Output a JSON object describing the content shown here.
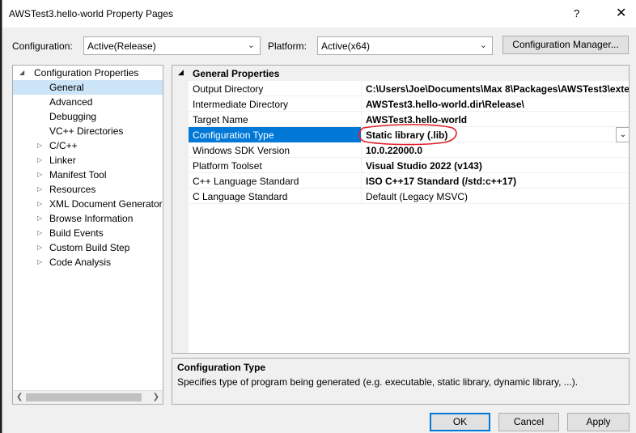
{
  "window": {
    "title": "AWSTest3.hello-world Property Pages",
    "help_glyph": "?",
    "close_glyph": "✕"
  },
  "toolbar": {
    "configuration_label": "Configuration:",
    "configuration_value": "Active(Release)",
    "platform_label": "Platform:",
    "platform_value": "Active(x64)",
    "configuration_manager_label": "Configuration Manager..."
  },
  "tree": {
    "root": "Configuration Properties",
    "items": [
      "General",
      "Advanced",
      "Debugging",
      "VC++ Directories",
      "C/C++",
      "Linker",
      "Manifest Tool",
      "Resources",
      "XML Document Generator",
      "Browse Information",
      "Build Events",
      "Custom Build Step",
      "Code Analysis"
    ],
    "selected": "General"
  },
  "grid": {
    "category": "General Properties",
    "rows": [
      {
        "name": "Output Directory",
        "value": "C:\\Users\\Joe\\Documents\\Max 8\\Packages\\AWSTest3\\exte"
      },
      {
        "name": "Intermediate Directory",
        "value": "AWSTest3.hello-world.dir\\Release\\"
      },
      {
        "name": "Target Name",
        "value": "AWSTest3.hello-world"
      },
      {
        "name": "Configuration Type",
        "value": "Static library (.lib)"
      },
      {
        "name": "Windows SDK Version",
        "value": "10.0.22000.0"
      },
      {
        "name": "Platform Toolset",
        "value": "Visual Studio 2022 (v143)"
      },
      {
        "name": "C++ Language Standard",
        "value": "ISO C++17 Standard (/std:c++17)"
      },
      {
        "name": "C Language Standard",
        "value": "Default (Legacy MSVC)"
      }
    ],
    "selected_row": "Configuration Type",
    "annotation_color": "#e0202a"
  },
  "description": {
    "title": "Configuration Type",
    "text": "Specifies type of program being generated (e.g. executable, static library, dynamic library, ...)."
  },
  "buttons": {
    "ok": "OK",
    "cancel": "Cancel",
    "apply": "Apply"
  },
  "colors": {
    "selection": "#0078d7",
    "dialog_bg": "#f0f0f0"
  }
}
